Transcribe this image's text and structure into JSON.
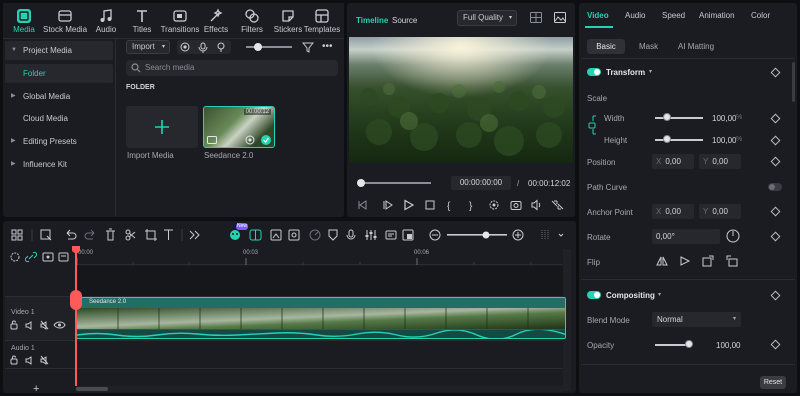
{
  "toolbar": {
    "items": [
      {
        "label": "Media",
        "icon": "media-icon",
        "active": true
      },
      {
        "label": "Stock Media",
        "icon": "stock-media-icon"
      },
      {
        "label": "Audio",
        "icon": "audio-icon"
      },
      {
        "label": "Titles",
        "icon": "titles-icon"
      },
      {
        "label": "Transitions",
        "icon": "transitions-icon"
      },
      {
        "label": "Effects",
        "icon": "effects-icon"
      },
      {
        "label": "Filters",
        "icon": "filters-icon"
      },
      {
        "label": "Stickers",
        "icon": "stickers-icon"
      },
      {
        "label": "Templates",
        "icon": "templates-icon"
      }
    ]
  },
  "sidebar": {
    "items": [
      {
        "label": "Project Media",
        "expanded": true
      },
      {
        "label": "Folder",
        "selected": true
      },
      {
        "label": "Global Media"
      },
      {
        "label": "Cloud Media"
      },
      {
        "label": "Editing Presets"
      },
      {
        "label": "Influence Kit"
      }
    ]
  },
  "media": {
    "import_label": "Import",
    "search_placeholder": "Search media",
    "folder_heading": "FOLDER",
    "import_media_label": "Import Media",
    "clip_name": "Seedance 2.0",
    "clip_duration": "00:00:12"
  },
  "viewer": {
    "tab_timeline": "Timeline",
    "tab_source": "Source",
    "quality": "Full Quality",
    "current_time": "00:00:00:00",
    "separator": "/",
    "total_time": "00:00:12:02"
  },
  "inspector": {
    "tabs": [
      "Video",
      "Audio",
      "Speed",
      "Animation",
      "Color"
    ],
    "subtabs": [
      "Basic",
      "Mask",
      "AI Matting"
    ],
    "transform": {
      "title": "Transform",
      "scale_label": "Scale",
      "width_label": "Width",
      "width_value": "100,00",
      "height_label": "Height",
      "height_value": "100,00",
      "percent": "%",
      "position_label": "Position",
      "position_x": "0,00",
      "position_y": "0,00",
      "path_curve_label": "Path Curve",
      "anchor_label": "Anchor Point",
      "anchor_x": "0,00",
      "anchor_y": "0,00",
      "rotate_label": "Rotate",
      "rotate_value": "0,00°",
      "flip_label": "Flip",
      "x_prefix": "X",
      "y_prefix": "Y"
    },
    "compositing": {
      "title": "Compositing",
      "blend_label": "Blend Mode",
      "blend_value": "Normal",
      "opacity_label": "Opacity",
      "opacity_value": "100,00"
    },
    "reset_label": "Reset"
  },
  "timeline": {
    "ruler": [
      "00:00",
      "00:03",
      "00:06"
    ],
    "video_track": "Video 1",
    "audio_track": "Audio 1",
    "clip_label": "Seedance 2.0",
    "new_badge": "New"
  },
  "colors": {
    "accent": "#25d2b3",
    "playhead": "#ff5a5a"
  }
}
